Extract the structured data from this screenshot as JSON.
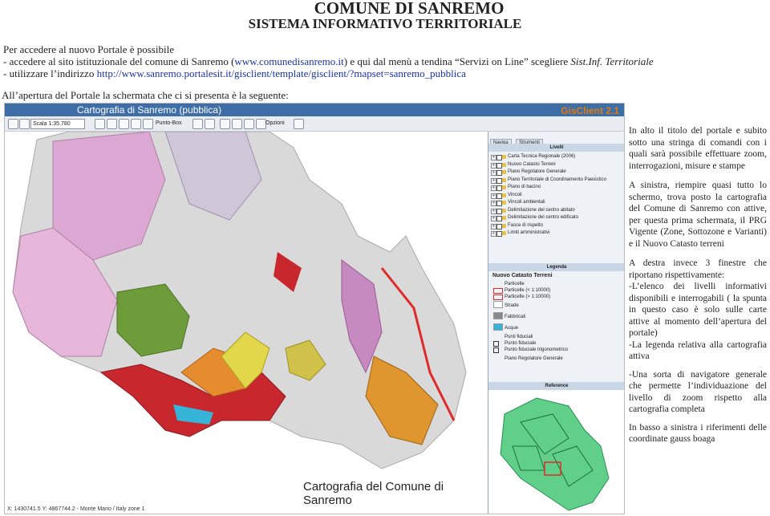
{
  "title": "COMUNE DI SANREMO",
  "subtitle": "SISTEMA INFORMATIVO TERRITORIALE",
  "intro": {
    "line1": "Per accedere al nuovo Portale è possibile",
    "bullet1_pre": "-    accedere al sito istituzionale del comune di Sanremo (",
    "bullet1_link": "www.comunedisanremo.it",
    "bullet1_post": ") e qui dal menù a tendina “Servizi on Line” scegliere ",
    "bullet1_ital": "Sist.Inf. Territoriale",
    "bullet2_pre": "-    utilizzare l’indirizzo ",
    "bullet2_link": "http://www.sanremo.portalesit.it/gisclient/template/gisclient/?mapset=sanremo_pubblica",
    "after": "All’apertura del Portale la schermata che ci si presenta è la seguente:"
  },
  "screenshot": {
    "window_title": "Cartografia di Sanremo (pubblica)",
    "logo": "GisClient 2.1",
    "scale_field": "Scala 1:35.780",
    "punto_box": "Punto-Box",
    "opzioni": "Opzioni",
    "coords": "X: 1430741.5 Y: 4867744.2 - Monte Mario / Italy zone 1",
    "map_caption": "Cartografia del Comune di Sanremo",
    "tabs": [
      "Naviga",
      "Strumenti"
    ],
    "layers_header": "Livelli",
    "layers": [
      "Carta Tecnica Regionale (2006)",
      "Nuovo Catasto Terreni",
      "Piano Regolatore Generale",
      "Piano Territoriale di Coordinamento Paesistico",
      "Piano di bacino",
      "Vincoli",
      "Vincoli ambientali",
      "Delimitazione del centro abitato",
      "Delimitazione del centro edificato",
      "Fasce di rispetto",
      "Limiti amministrativi"
    ],
    "legend_header": "Legenda",
    "legend_title": "Nuovo Catasto Terreni",
    "legend_items": [
      {
        "label": "Particelle",
        "color": "#ffffff"
      },
      {
        "label": "Particelle (< 1:10000)",
        "color": "#ffffff"
      },
      {
        "label": "Particelle (> 1:10000)",
        "color": "#ffffff"
      },
      {
        "label": "Strade",
        "color": "#ffffff"
      },
      {
        "label": "Fabbricati",
        "color": "#8a8a8a"
      },
      {
        "label": "Acque",
        "color": "#35b4d8"
      },
      {
        "label": "Punti fiduciali",
        "color": "#ffffff"
      },
      {
        "label": "Punto fiduciale",
        "color": "#ffffff"
      },
      {
        "label": "Punto fiduciale trigonometrico",
        "color": "#ffffff"
      },
      {
        "label": "Piano Regolatore Generale",
        "color": "#ffffff"
      }
    ],
    "reference_header": "Reference"
  },
  "description": [
    "In alto il titolo del portale e subito sotto una stringa di comandi con i quali sarà possibile effettuare zoom, interrogazioni, misure e stampe",
    "A sinistra, riempire quasi tutto lo schermo, trova posto la cartografia del Comune di Sanremo con attive, per questa prima schermata, il PRG Vigente (Zone, Sottozone e Varianti) e il Nuovo Catasto terreni",
    "A destra invece 3 finestre che riportano rispettivamente:",
    "-L’elenco dei livelli informativi disponibili e interrogabili ( la spunta in questo caso è solo sulle carte attive al momento dell’apertura del portale)",
    "-La legenda relativa alla cartografia attiva",
    "-Una sorta di navigatore generale che permette l’individuazione del livello di zoom rispetto alla cartografia completa",
    "In basso a sinistra i riferimenti delle coordinate gauss boaga"
  ]
}
